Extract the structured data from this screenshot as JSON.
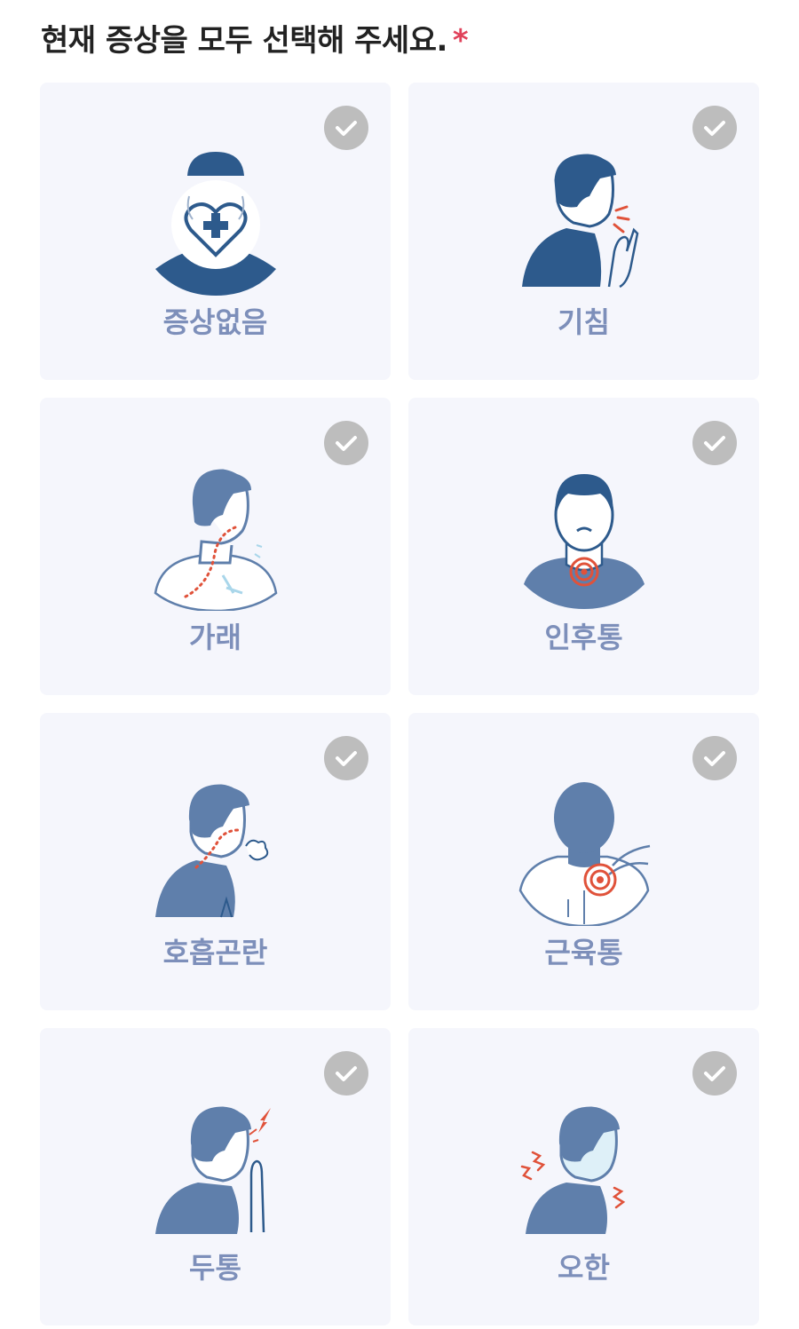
{
  "question": {
    "text": "현재 증상을 모두 선택해 주세요.",
    "required_mark": "*"
  },
  "colors": {
    "icon_dark": "#2d5a8c",
    "icon_mid": "#5f7fab",
    "accent_red": "#e0523a",
    "label": "#7d8fba",
    "card_bg": "#f5f6fc",
    "check_bg": "#bdbdbd"
  },
  "symptoms": [
    {
      "label": "증상없음",
      "icon": "healthy-person-icon",
      "selected": false
    },
    {
      "label": "기침",
      "icon": "cough-icon",
      "selected": false
    },
    {
      "label": "가래",
      "icon": "phlegm-icon",
      "selected": false
    },
    {
      "label": "인후통",
      "icon": "sore-throat-icon",
      "selected": false
    },
    {
      "label": "호흡곤란",
      "icon": "breathing-difficulty-icon",
      "selected": false
    },
    {
      "label": "근육통",
      "icon": "muscle-pain-icon",
      "selected": false
    },
    {
      "label": "두통",
      "icon": "headache-icon",
      "selected": false
    },
    {
      "label": "오한",
      "icon": "chills-icon",
      "selected": false
    }
  ]
}
